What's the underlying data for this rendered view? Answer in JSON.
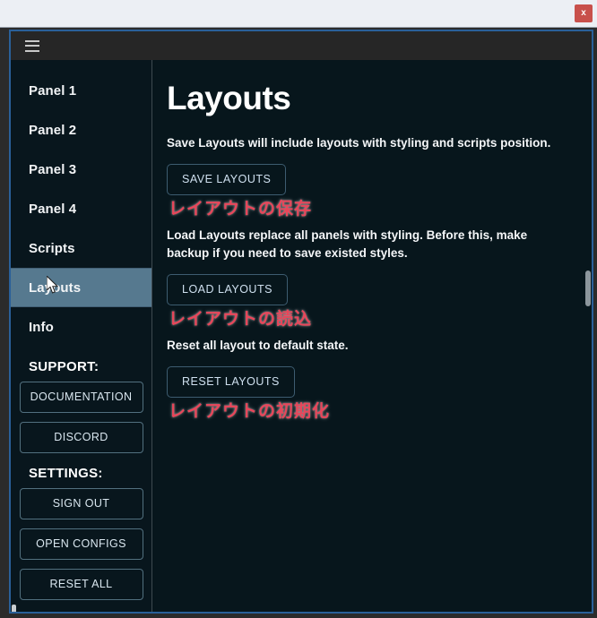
{
  "window": {
    "close_label": "x",
    "menu_icon": "hamburger-menu-icon"
  },
  "sidebar": {
    "nav_items": [
      {
        "label": "Panel 1",
        "active": false
      },
      {
        "label": "Panel 2",
        "active": false
      },
      {
        "label": "Panel 3",
        "active": false
      },
      {
        "label": "Panel 4",
        "active": false
      },
      {
        "label": "Scripts",
        "active": false
      },
      {
        "label": "Layouts",
        "active": true
      },
      {
        "label": "Info",
        "active": false
      }
    ],
    "support_heading": "SUPPORT:",
    "support_buttons": [
      {
        "label": "DOCUMENTATION"
      },
      {
        "label": "DISCORD"
      }
    ],
    "settings_heading": "SETTINGS:",
    "settings_buttons": [
      {
        "label": "SIGN OUT"
      },
      {
        "label": "OPEN CONFIGS"
      },
      {
        "label": "RESET ALL"
      }
    ]
  },
  "main": {
    "title": "Layouts",
    "sections": [
      {
        "description": "Save Layouts will include layouts with styling and scripts position.",
        "button_label": "SAVE LAYOUTS",
        "annotation": "レイアウトの保存"
      },
      {
        "description": "Load Layouts replace all panels with styling. Before this, make backup if you need to save existed styles.",
        "button_label": "LOAD LAYOUTS",
        "annotation": "レイアウトの読込"
      },
      {
        "description": "Reset all layout to default state.",
        "button_label": "RESET LAYOUTS",
        "annotation": "レイアウトの初期化"
      }
    ]
  },
  "colors": {
    "accent_blue": "#2a6099",
    "active_nav": "#56798f",
    "annotation_red": "#e8465a",
    "close_red": "#c8504b",
    "app_background": "#07161c",
    "titlebar": "#262626"
  }
}
